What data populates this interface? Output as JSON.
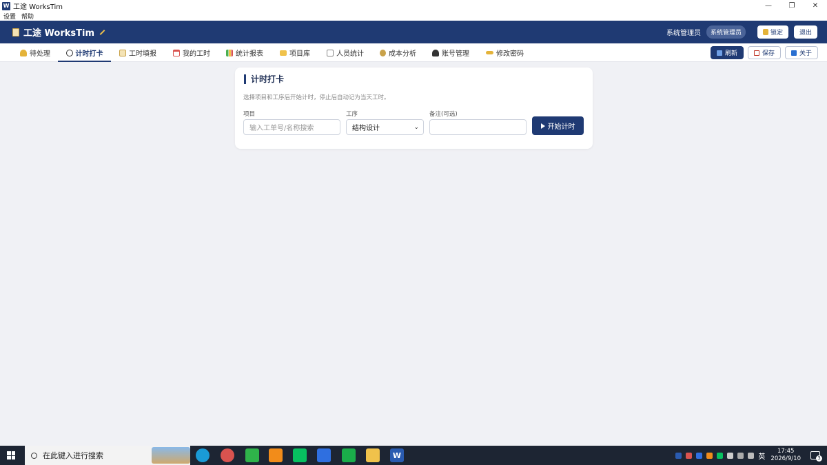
{
  "window": {
    "icon_letter": "W",
    "title": "工途 WorksTim",
    "minimize": "—",
    "maximize": "❐",
    "close": "✕"
  },
  "menu": [
    "设置",
    "帮助"
  ],
  "header": {
    "brand": "工途 WorksTim",
    "role_text": "系统管理员",
    "role_badge": "系统管理员",
    "lock_label": "锁定",
    "logout_label": "退出"
  },
  "tabs": [
    {
      "label": "待处理",
      "icon": "bell-icon",
      "color": "#e4b33a"
    },
    {
      "label": "计时打卡",
      "icon": "stopwatch-icon",
      "color": "#333333",
      "active": true
    },
    {
      "label": "工时填报",
      "icon": "memo-icon",
      "color": "#c9a24a"
    },
    {
      "label": "我的工时",
      "icon": "calendar-icon",
      "color": "#d9534f"
    },
    {
      "label": "统计报表",
      "icon": "chart-icon",
      "color": "#4caf50"
    },
    {
      "label": "项目库",
      "icon": "folder-icon",
      "color": "#f0c24b"
    },
    {
      "label": "人员统计",
      "icon": "chart-up-icon",
      "color": "#d9534f"
    },
    {
      "label": "成本分析",
      "icon": "money-bag-icon",
      "color": "#c9a24a"
    },
    {
      "label": "账号管理",
      "icon": "users-icon",
      "color": "#333333"
    },
    {
      "label": "修改密码",
      "icon": "key-icon",
      "color": "#e4b33a"
    }
  ],
  "toolbar": {
    "refresh": "刷新",
    "save": "保存",
    "about": "关于"
  },
  "timer": {
    "title": "计时打卡",
    "description": "选择项目和工序后开始计时，停止后自动记为当天工时。",
    "project_label": "项目",
    "project_placeholder": "输入工单号/名称搜索",
    "process_label": "工序",
    "process_value": "结构设计",
    "note_label": "备注(可选)",
    "note_value": "",
    "start_button": "开始计时"
  },
  "taskbar": {
    "search_placeholder": "在此键入进行搜索",
    "word_letter": "W",
    "ime": "英",
    "time": "17:45",
    "date": "2026/9/10",
    "notifications": "3"
  },
  "colors": {
    "primary": "#1f3a73",
    "background": "#f0f1f5"
  }
}
